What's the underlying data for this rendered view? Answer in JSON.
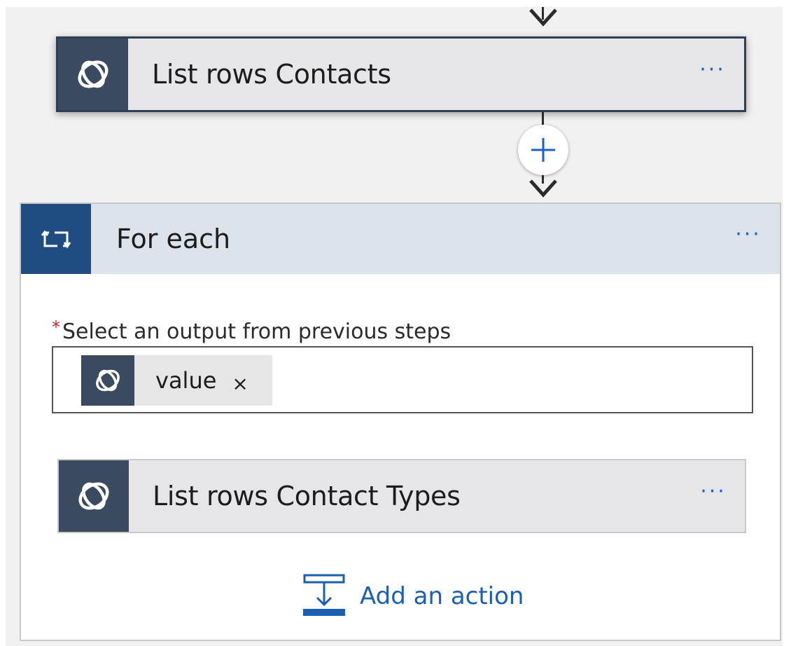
{
  "flow": {
    "list_contacts": {
      "title": "List rows Contacts",
      "more": "···",
      "icon": "dataverse-icon"
    },
    "insert_step": {
      "icon": "plus-icon"
    },
    "for_each": {
      "title": "For each",
      "more": "···",
      "icon": "loop-icon",
      "field_required_marker": "*",
      "field_label": "Select an output from previous steps",
      "token": {
        "label": "value",
        "remove": "×",
        "icon": "dataverse-icon"
      },
      "inner_action": {
        "title": "List rows Contact Types",
        "more": "···",
        "icon": "dataverse-icon"
      },
      "add_action": {
        "label": "Add an action",
        "icon": "add-action-icon"
      }
    }
  },
  "colors": {
    "accent_blue": "#1a62c9",
    "connector_dark": "#3b4a60",
    "loop_blue": "#1f4d82",
    "required_red": "#c62828"
  }
}
